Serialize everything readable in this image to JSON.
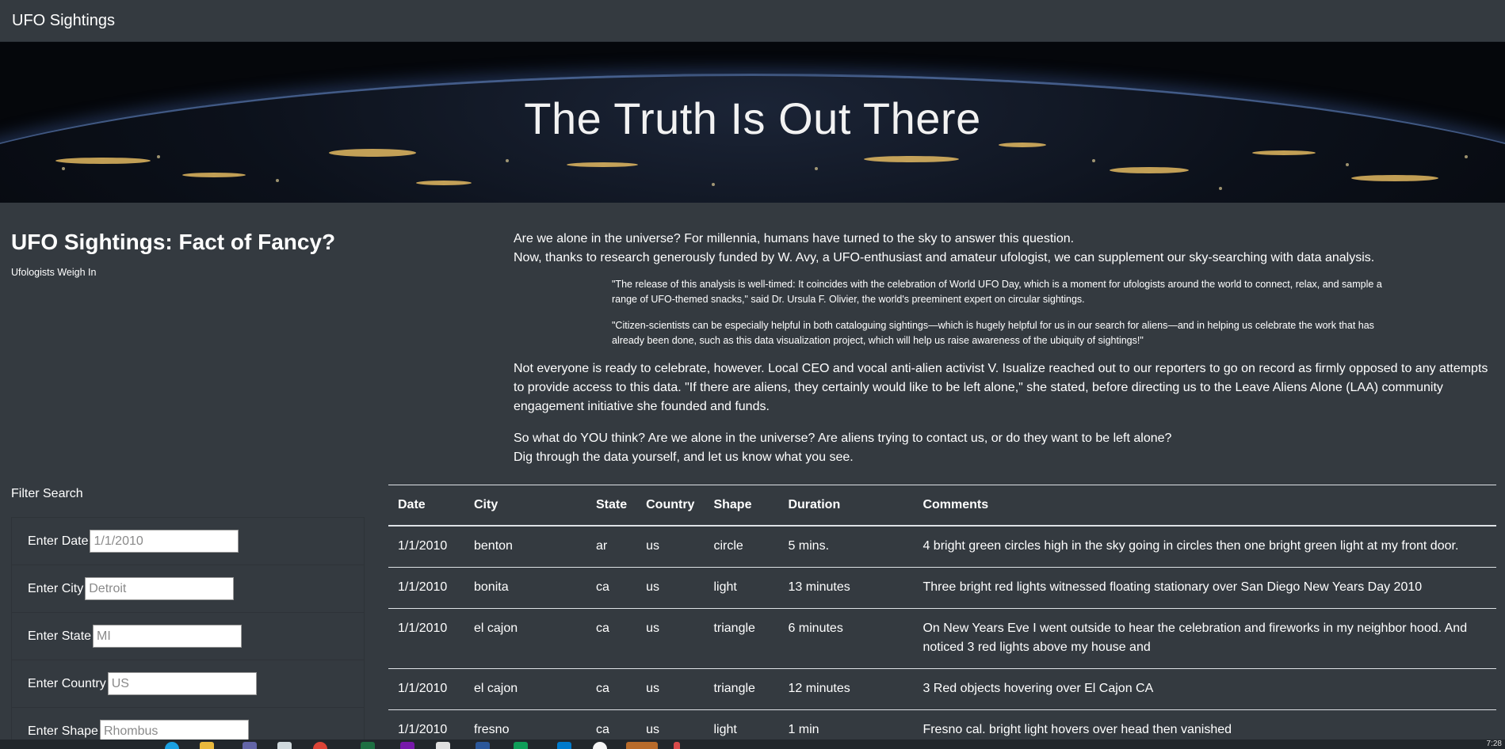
{
  "nav": {
    "brand": "UFO Sightings"
  },
  "hero": {
    "title": "The Truth Is Out There"
  },
  "intro": {
    "title": "UFO Sightings: Fact of Fancy?",
    "subtitle": "Ufologists Weigh In"
  },
  "article": {
    "p1_line1": "Are we alone in the universe? For millennia, humans have turned to the sky to answer this question.",
    "p1_line2": "Now, thanks to research generously funded by W. Avy, a UFO-enthusiast and amateur ufologist, we can supplement our sky-searching with data analysis.",
    "quote1": "\"The release of this analysis is well-timed: It coincides with the celebration of World UFO Day, which is a moment for ufologists around the world to connect, relax, and sample a range of UFO-themed snacks,\" said Dr. Ursula F. Olivier, the world's preeminent expert on circular sightings.",
    "quote2": "\"Citizen-scientists can be especially helpful in both cataloguing sightings—which is hugely helpful for us in our search for aliens—and in helping us celebrate the work that has already been done, such as this data visualization project, which will help us raise awareness of the ubiquity of sightings!\"",
    "p3": "Not everyone is ready to celebrate, however. Local CEO and vocal anti-alien activist V. Isualize reached out to our reporters to go on record as firmly opposed to any attempts to provide access to this data. \"If there are aliens, they certainly would like to be left alone,\" she stated, before directing us to the Leave Aliens Alone (LAA) community engagement initiative she founded and funds.",
    "p4_line1": "So what do YOU think? Are we alone in the universe? Are aliens trying to contact us, or do they want to be left alone?",
    "p4_line2": "Dig through the data yourself, and let us know what you see."
  },
  "filter": {
    "heading": "Filter Search",
    "fields": [
      {
        "label": "Enter Date",
        "placeholder": "1/1/2010"
      },
      {
        "label": "Enter City",
        "placeholder": "Detroit"
      },
      {
        "label": "Enter State",
        "placeholder": "MI"
      },
      {
        "label": "Enter Country",
        "placeholder": "US"
      },
      {
        "label": "Enter Shape",
        "placeholder": "Rhombus"
      }
    ]
  },
  "table": {
    "headers": [
      "Date",
      "City",
      "State",
      "Country",
      "Shape",
      "Duration",
      "Comments"
    ],
    "rows": [
      [
        "1/1/2010",
        "benton",
        "ar",
        "us",
        "circle",
        "5 mins.",
        "4 bright green circles high in the sky going in circles then one bright green light at my front door."
      ],
      [
        "1/1/2010",
        "bonita",
        "ca",
        "us",
        "light",
        "13 minutes",
        "Three bright red lights witnessed floating stationary over San Diego New Years Day 2010"
      ],
      [
        "1/1/2010",
        "el cajon",
        "ca",
        "us",
        "triangle",
        "6 minutes",
        "On New Years Eve I went outside to hear the celebration and fireworks in my neighbor hood. And noticed 3 red lights above my house and"
      ],
      [
        "1/1/2010",
        "el cajon",
        "ca",
        "us",
        "triangle",
        "12 minutes",
        "3 Red objects hovering over El Cajon CA"
      ],
      [
        "1/1/2010",
        "fresno",
        "ca",
        "us",
        "light",
        "1 min",
        "Fresno cal. bright light hovers over head then vanished"
      ]
    ]
  },
  "taskbar": {
    "time": "7:28"
  }
}
